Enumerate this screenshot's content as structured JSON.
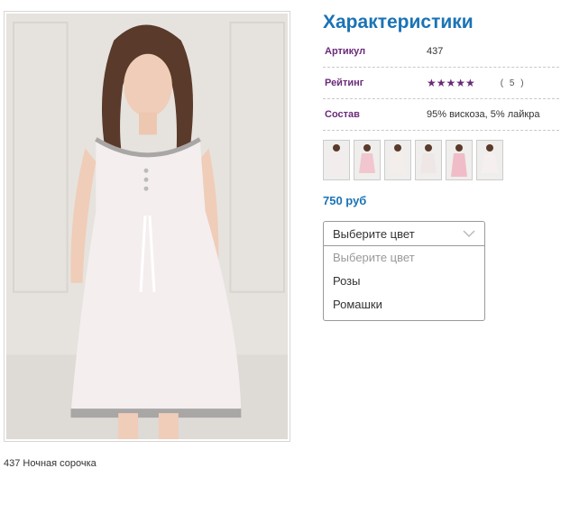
{
  "product": {
    "caption": "437 Ночная сорочка",
    "photo_alt": "product-photo"
  },
  "details": {
    "title": "Характеристики",
    "specs": [
      {
        "key": "Артикул",
        "value": "437"
      },
      {
        "key": "Рейтинг",
        "stars": "★★★★★",
        "count": "( 5 )"
      },
      {
        "key": "Состав",
        "value": "95% вискоза, 5% лайкра"
      }
    ],
    "price": "750 руб"
  },
  "color_select": {
    "selected": "Выберите цвет",
    "options": [
      "Выберите цвет",
      "Розы",
      "Ромашки"
    ]
  },
  "colors": {
    "title": "#1a73b5",
    "spec_key": "#6b2a7a",
    "price": "#1a73b5"
  }
}
